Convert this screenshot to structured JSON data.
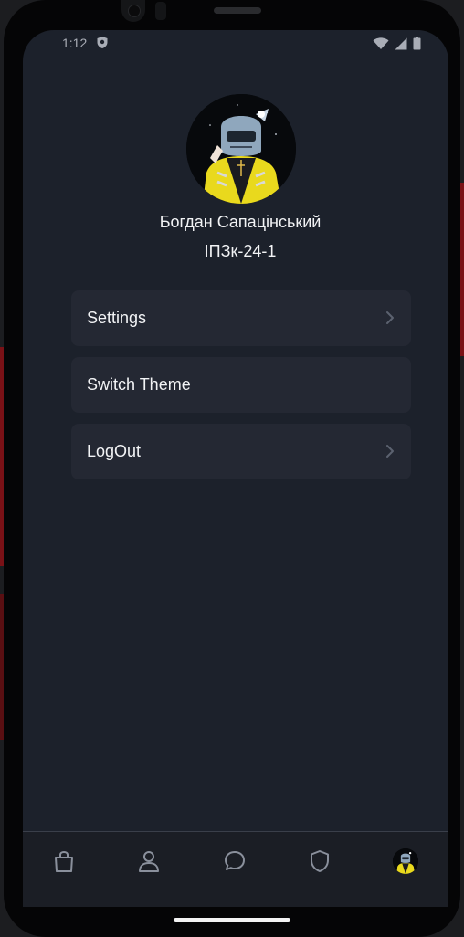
{
  "status_bar": {
    "time": "1:12"
  },
  "profile": {
    "name": "Богдан Сапацінський",
    "group": "ІПЗк-24-1"
  },
  "menu": [
    {
      "label": "Settings",
      "has_chevron": true
    },
    {
      "label": "Switch Theme",
      "has_chevron": false
    },
    {
      "label": "LogOut",
      "has_chevron": true
    }
  ],
  "tabs": [
    {
      "icon": "shopping-bag-icon"
    },
    {
      "icon": "user-icon"
    },
    {
      "icon": "chat-bubble-icon"
    },
    {
      "icon": "shield-icon"
    },
    {
      "icon": "profile-avatar-icon"
    }
  ],
  "colors": {
    "screen_background": "#1c212b",
    "card_background": "#242833",
    "text": "#f2f3f5",
    "icon_inactive": "#8a909c",
    "tabbar_border": "#3a3f4a"
  }
}
